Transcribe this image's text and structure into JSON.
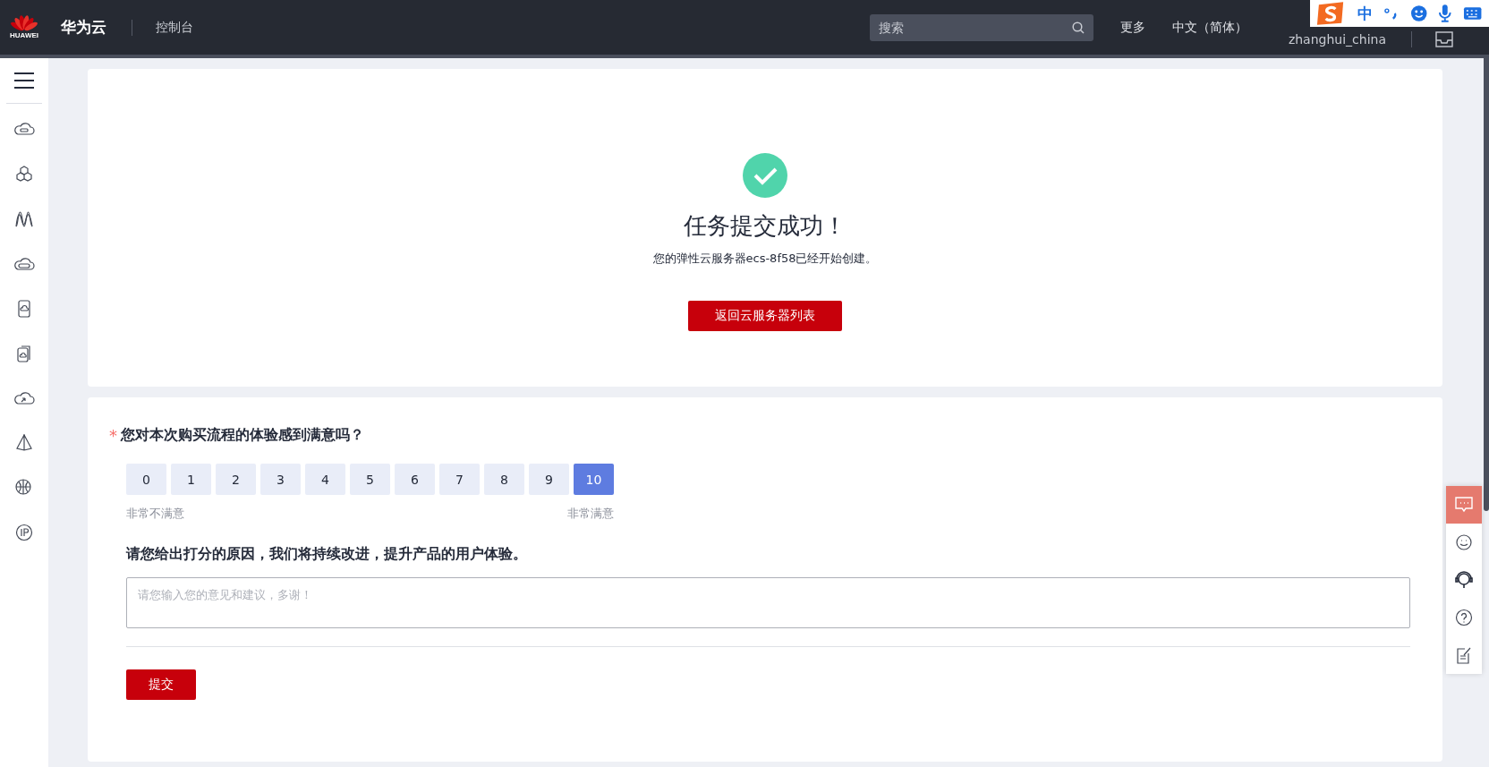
{
  "topbar": {
    "logo_text": "HUAWEI",
    "brand": "华为云",
    "console": "控制台",
    "search": {
      "placeholder": "搜索"
    },
    "links": [
      "更多",
      "中文（简体）"
    ],
    "user": "zhanghui_china"
  },
  "ime_bar": {
    "mode": "中"
  },
  "success": {
    "title": "任务提交成功！",
    "message": "您的弹性云服务器ecs-8f58已经开始创建。",
    "button": "返回云服务器列表"
  },
  "survey": {
    "question": "您对本次购买流程的体验感到满意吗？",
    "required_mark": "*",
    "scores": [
      {
        "label": "0",
        "selected": false
      },
      {
        "label": "1",
        "selected": false
      },
      {
        "label": "2",
        "selected": false
      },
      {
        "label": "3",
        "selected": false
      },
      {
        "label": "4",
        "selected": false
      },
      {
        "label": "5",
        "selected": false
      },
      {
        "label": "6",
        "selected": false
      },
      {
        "label": "7",
        "selected": false
      },
      {
        "label": "8",
        "selected": false
      },
      {
        "label": "9",
        "selected": false
      },
      {
        "label": "10",
        "selected": true
      }
    ],
    "low_label": "非常不满意",
    "high_label": "非常满意",
    "reason_prompt": "请您给出打分的原因，我们将持续改进，提升产品的用户体验。",
    "feedback": {
      "placeholder": "请您输入您的意见和建议，多谢！"
    },
    "submit": "提交"
  }
}
